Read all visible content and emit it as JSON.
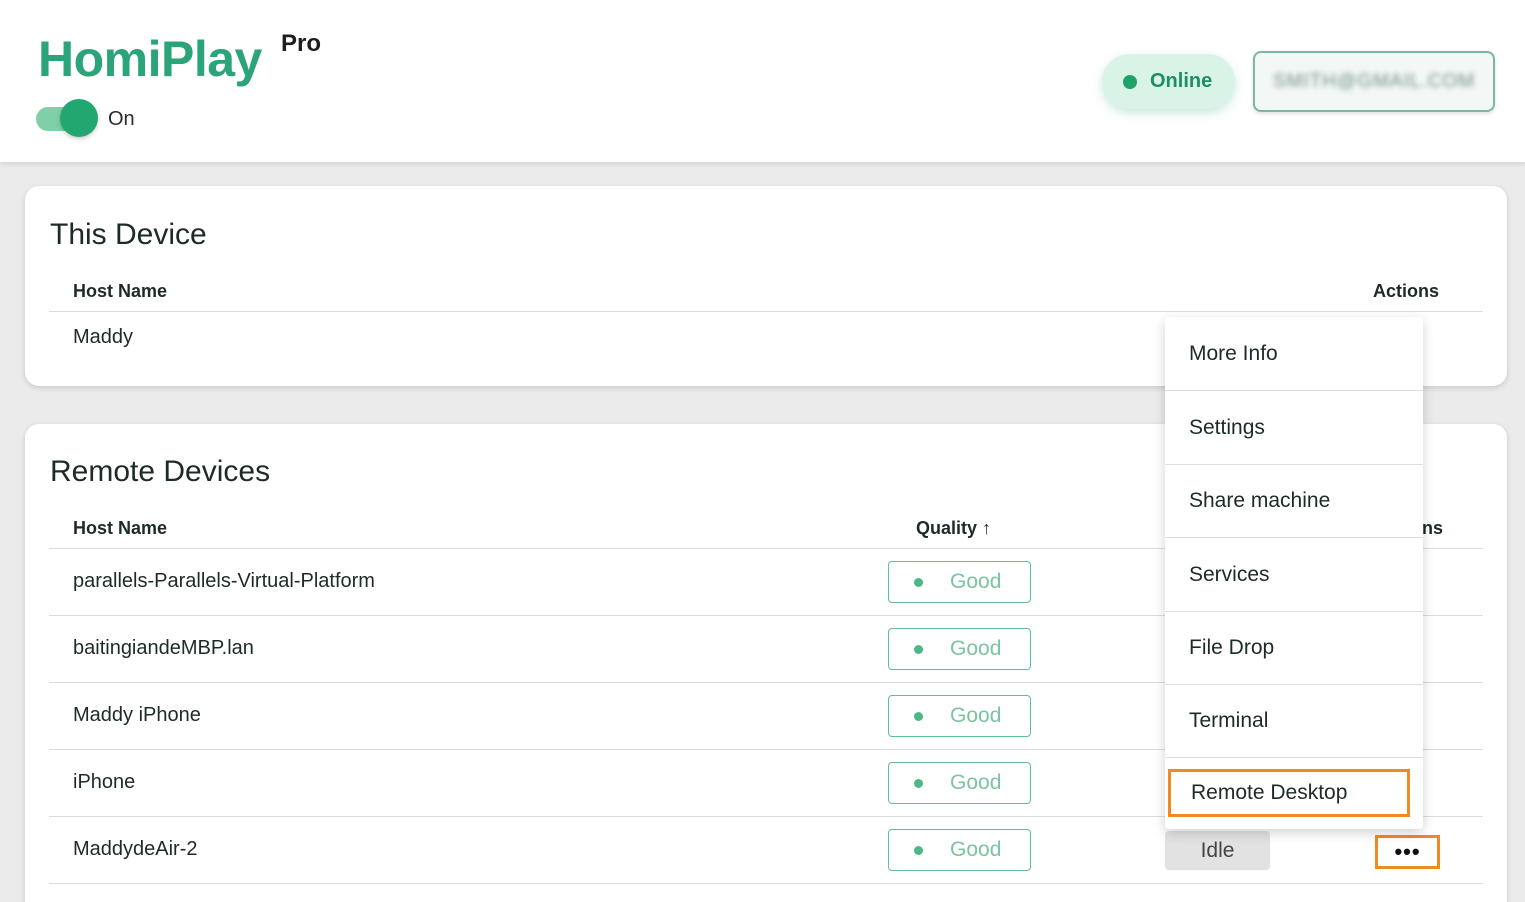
{
  "header": {
    "brand": "HomiPlay",
    "brand_tier": "Pro",
    "toggle_label": "On",
    "status": "Online",
    "account_email": "SMITH@GMAIL.COM"
  },
  "this_device": {
    "title": "This Device",
    "columns": {
      "host": "Host Name",
      "actions": "Actions"
    },
    "host": "Maddy"
  },
  "remote_devices": {
    "title": "Remote Devices",
    "columns": {
      "host": "Host Name",
      "quality": "Quality ↑",
      "actions_partial": "ns"
    },
    "rows": [
      {
        "host": "parallels-Parallels-Virtual-Platform",
        "quality": "Good"
      },
      {
        "host": "baitingiandeMBP.lan",
        "quality": "Good"
      },
      {
        "host": "Maddy iPhone",
        "quality": "Good"
      },
      {
        "host": "iPhone",
        "quality": "Good"
      },
      {
        "host": "MaddydeAir-2",
        "quality": "Good",
        "status": "Idle",
        "more": "•••"
      }
    ]
  },
  "context_menu": {
    "items": [
      "More Info",
      "Settings",
      "Share machine",
      "Services",
      "File Drop",
      "Terminal",
      "Remote Desktop"
    ]
  },
  "colors": {
    "brand": "#2aa478",
    "highlight": "#f08a24",
    "good": "#7cc3a2"
  }
}
